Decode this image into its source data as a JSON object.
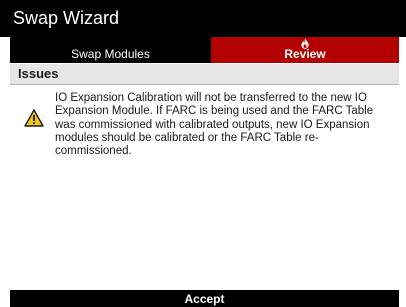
{
  "window": {
    "title": "Swap Wizard"
  },
  "tabs": [
    {
      "label": "Swap Modules",
      "active": false
    },
    {
      "label": "Review",
      "active": true,
      "icon": "flame-icon"
    }
  ],
  "section": {
    "title": "Issues"
  },
  "issues": [
    {
      "icon": "warning-icon",
      "text": "IO Expansion Calibration will not be transferred to the new IO Expansion Module. If FARC is being used and the FARC Table was commissioned with calibrated outputs, new IO Expansion modules should be calibrated or the FARC Table re-commissioned."
    }
  ],
  "footer": {
    "accept_label": "Accept"
  },
  "colors": {
    "active_tab": "#b30000",
    "chrome": "#000000",
    "warning": "#f5c518"
  }
}
